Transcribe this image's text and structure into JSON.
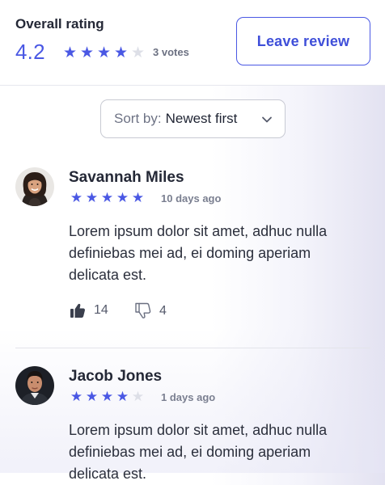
{
  "summary": {
    "title": "Overall rating",
    "score": "4.2",
    "stars_filled": 4,
    "stars_total": 5,
    "votes": "3 votes"
  },
  "actions": {
    "leave_review_label": "Leave review"
  },
  "sort": {
    "prefix": "Sort by:",
    "value": "Newest first"
  },
  "reviews": [
    {
      "name": "Savannah Miles",
      "stars_filled": 5,
      "time": "10 days ago",
      "body": "Lorem ipsum dolor sit amet, adhuc nulla definiebas mei ad, ei doming aperiam delicata est.",
      "likes": "14",
      "dislikes": "4"
    },
    {
      "name": "Jacob Jones",
      "stars_filled": 4,
      "time": "1 days ago",
      "body": "Lorem ipsum dolor sit amet, adhuc nulla definiebas mei ad, ei doming aperiam delicata est."
    }
  ],
  "colors": {
    "accent": "#4a58e4",
    "star_empty": "#dddfe7"
  },
  "icons": [
    "star-icon",
    "chevron-down-icon",
    "thumbs-up-icon",
    "thumbs-down-icon"
  ]
}
